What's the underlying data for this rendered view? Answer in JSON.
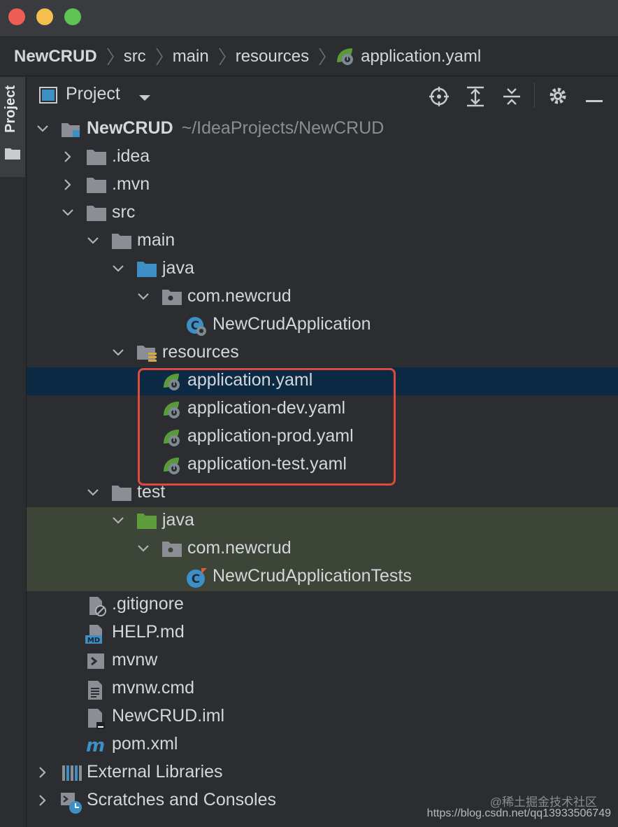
{
  "breadcrumb": {
    "items": [
      "NewCRUD",
      "src",
      "main",
      "resources"
    ],
    "file": "application.yaml"
  },
  "side_tab": {
    "label": "Project"
  },
  "toolbar": {
    "title": "Project"
  },
  "tree": {
    "root_name": "NewCRUD",
    "root_path": "~/IdeaProjects/NewCRUD",
    "idea": ".idea",
    "mvn": ".mvn",
    "src": "src",
    "main": "main",
    "main_java": "java",
    "main_pkg": "com.newcrud",
    "main_class": "NewCrudApplication",
    "resources": "resources",
    "yaml1": "application.yaml",
    "yaml2": "application-dev.yaml",
    "yaml3": "application-prod.yaml",
    "yaml4": "application-test.yaml",
    "test": "test",
    "test_java": "java",
    "test_pkg": "com.newcrud",
    "test_class": "NewCrudApplicationTests",
    "gitignore": ".gitignore",
    "help": "HELP.md",
    "mvnw": "mvnw",
    "mvnw_cmd": "mvnw.cmd",
    "iml": "NewCRUD.iml",
    "pom": "pom.xml",
    "ext_libs": "External Libraries",
    "scratches": "Scratches and Consoles"
  },
  "watermark": {
    "line1": "@稀土掘金技术社区",
    "line2": "https://blog.csdn.net/qq13933506749"
  },
  "colors": {
    "selection": "#0d2a44",
    "test_highlight": "#3c4538",
    "annotation_box": "#e04a3a",
    "spring_green": "#5a9a3a",
    "java_folder": "#3d8fc6",
    "test_folder": "#5f9d3c"
  }
}
